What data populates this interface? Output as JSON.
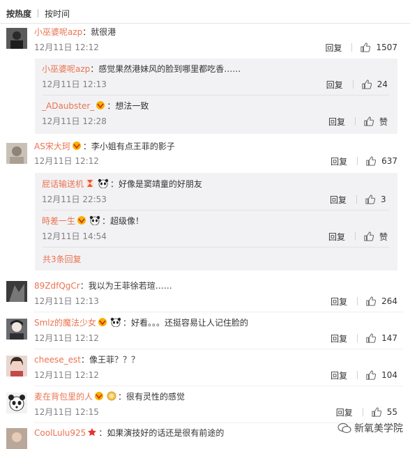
{
  "sort": {
    "hot": "按热度",
    "time": "按时间"
  },
  "reply_label": "回复",
  "comments": [
    {
      "user": "小巫婆呢azp",
      "text": "：就很港",
      "time": "12月11日 12:12",
      "likes": "1507",
      "replies": [
        {
          "user": "小巫婆呢azp",
          "text": "：感觉果然港妹风的脸到哪里都吃香……",
          "time": "12月11日 12:13",
          "likes": "24"
        },
        {
          "user": "_ADaubster_",
          "text": "：想法一致",
          "time": "12月11日 12:28",
          "likes": "赞"
        }
      ]
    },
    {
      "user": "AS宋大珂",
      "text": "：李小姐有点王菲的影子",
      "time": "12月11日 12:12",
      "likes": "637",
      "replies": [
        {
          "user": "屁话输送机",
          "text": "：好像是窦靖童的好朋友",
          "time": "12月11日 22:53",
          "likes": "3"
        },
        {
          "user": "時差一生",
          "text": "：超级像！",
          "time": "12月11日 14:54",
          "likes": "赞"
        }
      ],
      "more": "共3条回复"
    },
    {
      "user": "89ZdfQgCr",
      "text": "：我以为王菲徐若瑄……",
      "time": "12月11日 12:13",
      "likes": "264"
    },
    {
      "user": "Smlz的魔法少女",
      "text": "：好看。。。还挺容易让人记住脸的",
      "time": "12月11日 12:12",
      "likes": "147"
    },
    {
      "user": "cheese_est",
      "text": "：像王菲？？？",
      "time": "12月11日 12:12",
      "likes": "104"
    },
    {
      "user": "麦在背包里的人",
      "text": "：很有灵性的感觉",
      "time": "12月11日 12:15",
      "likes": "55"
    },
    {
      "user": "CoolLulu925",
      "text": "：如果演技好的话还是很有前途的"
    }
  ],
  "watermark": "新氧美学院",
  "colors": {
    "username": "#eb7350",
    "subbox": "#f2f2f5",
    "text": "#333333",
    "time": "#808080"
  }
}
